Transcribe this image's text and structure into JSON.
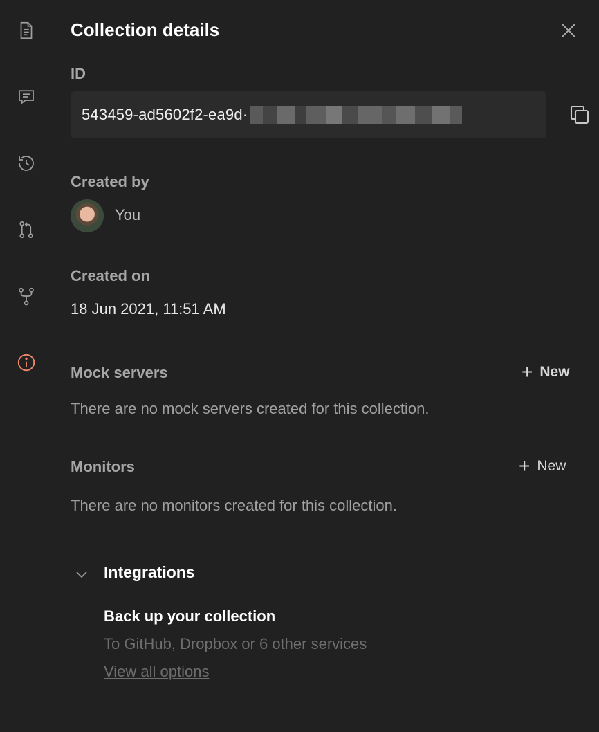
{
  "rail": {
    "items": [
      {
        "icon": "document-icon",
        "color": "#9e9e9e"
      },
      {
        "icon": "comment-icon",
        "color": "#9e9e9e"
      },
      {
        "icon": "history-icon",
        "color": "#9e9e9e"
      },
      {
        "icon": "pull-request-icon",
        "color": "#9e9e9e"
      },
      {
        "icon": "fork-icon",
        "color": "#9e9e9e"
      },
      {
        "icon": "info-icon",
        "color": "#f0896a"
      }
    ]
  },
  "panel": {
    "title": "Collection details",
    "id_label": "ID",
    "id_value": "543459-ad5602f2-ea9d·",
    "created_by_label": "Created by",
    "created_by_value": "You",
    "created_on_label": "Created on",
    "created_on_value": "18 Jun 2021, 11:51 AM"
  },
  "mock_servers": {
    "label": "Mock servers",
    "new_label": "New",
    "empty_text": "There are no mock servers created for this collection."
  },
  "monitors": {
    "label": "Monitors",
    "new_label": "New",
    "empty_text": "There are no monitors created for this collection."
  },
  "integrations": {
    "title": "Integrations",
    "backup_title": "Back up your collection",
    "backup_subtitle": "To GitHub, Dropbox or 6 other services",
    "view_all_label": "View all options"
  },
  "colors": {
    "background": "#212121",
    "accent": "#f0896a",
    "id_box": "#2b2b2b"
  }
}
